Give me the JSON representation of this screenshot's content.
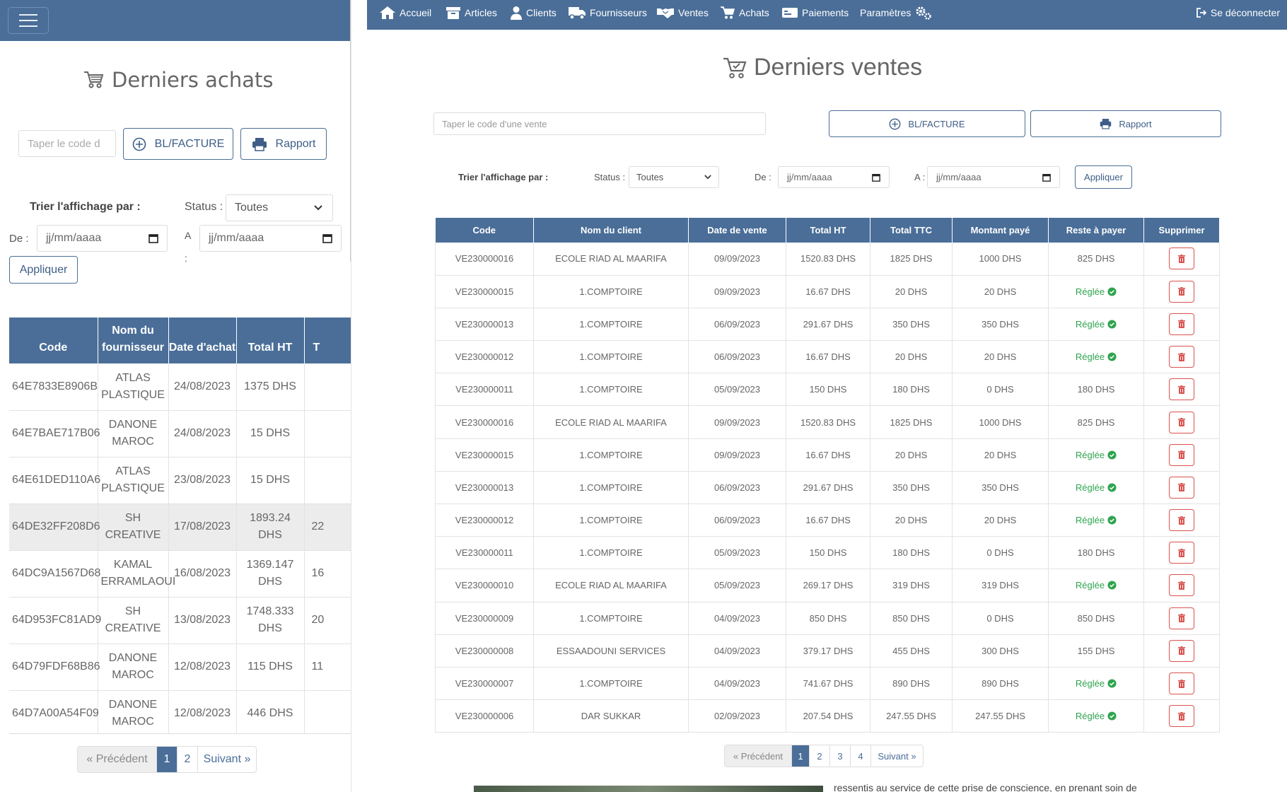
{
  "left_panel": {
    "title": "Derniers achats",
    "search_placeholder": "Taper le code d",
    "bl_label": "BL/FACTURE",
    "rapport_label": "Rapport",
    "sort_label": "Trier l'affichage par :",
    "status_label": "Status :",
    "status_value": "Toutes",
    "de_label": "De :",
    "a_label": "A :",
    "date_placeholder": "jj/mm/aaaa",
    "apply_label": "Appliquer",
    "columns": [
      "Code",
      "Nom du fournisseur",
      "Date d'achat",
      "Total HT",
      "T"
    ],
    "rows": [
      {
        "code": "64E7833E8906B",
        "fournisseur": "ATLAS PLASTIQUE",
        "date": "24/08/2023",
        "total_ht": "1375 DHS",
        "extra": ""
      },
      {
        "code": "64E7BAE717B06",
        "fournisseur": "DANONE MAROC",
        "date": "24/08/2023",
        "total_ht": "15 DHS",
        "extra": ""
      },
      {
        "code": "64E61DED110A6",
        "fournisseur": "ATLAS PLASTIQUE",
        "date": "23/08/2023",
        "total_ht": "15 DHS",
        "extra": ""
      },
      {
        "code": "64DE32FF208D6",
        "fournisseur": "SH CREATIVE",
        "date": "17/08/2023",
        "total_ht": "1893.24 DHS",
        "extra": "22"
      },
      {
        "code": "64DC9A1567D68",
        "fournisseur": "KAMAL ERRAMLAOUI",
        "date": "16/08/2023",
        "total_ht": "1369.147 DHS",
        "extra": "16"
      },
      {
        "code": "64D953FC81AD9",
        "fournisseur": "SH CREATIVE",
        "date": "13/08/2023",
        "total_ht": "1748.333 DHS",
        "extra": "20"
      },
      {
        "code": "64D79FDF68B86",
        "fournisseur": "DANONE MAROC",
        "date": "12/08/2023",
        "total_ht": "115 DHS",
        "extra": "11"
      },
      {
        "code": "64D7A00A54F09",
        "fournisseur": "DANONE MAROC",
        "date": "12/08/2023",
        "total_ht": "446 DHS",
        "extra": ""
      }
    ],
    "pager": {
      "prev": "« Précédent",
      "pages": [
        "1",
        "2"
      ],
      "next": "Suivant »"
    }
  },
  "nav": {
    "items": [
      "Accueil",
      "Articles",
      "Clients",
      "Fournisseurs",
      "Ventes",
      "Achats",
      "Paiements",
      "Paramètres"
    ],
    "logout": "Se déconnecter"
  },
  "right_panel": {
    "title": "Derniers ventes",
    "search_placeholder": "Taper le code d'une vente",
    "bl_label": "BL/FACTURE",
    "rapport_label": "Rapport",
    "sort_label": "Trier l'affichage par :",
    "status_label": "Status :",
    "status_value": "Toutes",
    "de_label": "De :",
    "a_label": "A :",
    "date_placeholder": "jj/mm/aaaa",
    "apply_label": "Appliquer",
    "columns": [
      "Code",
      "Nom du client",
      "Date de vente",
      "Total HT",
      "Total TTC",
      "Montant payé",
      "Reste à payer",
      "Supprimer"
    ],
    "rows": [
      {
        "code": "VE230000016",
        "client": "ECOLE RIAD AL MAARIFA",
        "date": "09/09/2023",
        "total_ht": "1520.83 DHS",
        "total_ttc": "1825 DHS",
        "paye": "1000 DHS",
        "reste": "825 DHS"
      },
      {
        "code": "VE230000015",
        "client": "1.COMPTOIRE",
        "date": "09/09/2023",
        "total_ht": "16.67 DHS",
        "total_ttc": "20 DHS",
        "paye": "20 DHS",
        "reste": "Réglée"
      },
      {
        "code": "VE230000013",
        "client": "1.COMPTOIRE",
        "date": "06/09/2023",
        "total_ht": "291.67 DHS",
        "total_ttc": "350 DHS",
        "paye": "350 DHS",
        "reste": "Réglée"
      },
      {
        "code": "VE230000012",
        "client": "1.COMPTOIRE",
        "date": "06/09/2023",
        "total_ht": "16.67 DHS",
        "total_ttc": "20 DHS",
        "paye": "20 DHS",
        "reste": "Réglée"
      },
      {
        "code": "VE230000011",
        "client": "1.COMPTOIRE",
        "date": "05/09/2023",
        "total_ht": "150 DHS",
        "total_ttc": "180 DHS",
        "paye": "0 DHS",
        "reste": "180 DHS"
      },
      {
        "code": "VE230000016",
        "client": "ECOLE RIAD AL MAARIFA",
        "date": "09/09/2023",
        "total_ht": "1520.83 DHS",
        "total_ttc": "1825 DHS",
        "paye": "1000 DHS",
        "reste": "825 DHS"
      },
      {
        "code": "VE230000015",
        "client": "1.COMPTOIRE",
        "date": "09/09/2023",
        "total_ht": "16.67 DHS",
        "total_ttc": "20 DHS",
        "paye": "20 DHS",
        "reste": "Réglée"
      },
      {
        "code": "VE230000013",
        "client": "1.COMPTOIRE",
        "date": "06/09/2023",
        "total_ht": "291.67 DHS",
        "total_ttc": "350 DHS",
        "paye": "350 DHS",
        "reste": "Réglée"
      },
      {
        "code": "VE230000012",
        "client": "1.COMPTOIRE",
        "date": "06/09/2023",
        "total_ht": "16.67 DHS",
        "total_ttc": "20 DHS",
        "paye": "20 DHS",
        "reste": "Réglée"
      },
      {
        "code": "VE230000011",
        "client": "1.COMPTOIRE",
        "date": "05/09/2023",
        "total_ht": "150 DHS",
        "total_ttc": "180 DHS",
        "paye": "0 DHS",
        "reste": "180 DHS"
      },
      {
        "code": "VE230000010",
        "client": "ECOLE RIAD AL MAARIFA",
        "date": "05/09/2023",
        "total_ht": "269.17 DHS",
        "total_ttc": "319 DHS",
        "paye": "319 DHS",
        "reste": "Réglée"
      },
      {
        "code": "VE230000009",
        "client": "1.COMPTOIRE",
        "date": "04/09/2023",
        "total_ht": "850 DHS",
        "total_ttc": "850 DHS",
        "paye": "0 DHS",
        "reste": "850 DHS"
      },
      {
        "code": "VE230000008",
        "client": "ESSAADOUNI SERVICES",
        "date": "04/09/2023",
        "total_ht": "379.17 DHS",
        "total_ttc": "455 DHS",
        "paye": "300 DHS",
        "reste": "155 DHS"
      },
      {
        "code": "VE230000007",
        "client": "1.COMPTOIRE",
        "date": "04/09/2023",
        "total_ht": "741.67 DHS",
        "total_ttc": "890 DHS",
        "paye": "890 DHS",
        "reste": "Réglée"
      },
      {
        "code": "VE230000006",
        "client": "DAR SUKKAR",
        "date": "02/09/2023",
        "total_ht": "207.54 DHS",
        "total_ttc": "247.55 DHS",
        "paye": "247.55 DHS",
        "reste": "Réglée"
      }
    ],
    "pager": {
      "prev": "« Précédent",
      "pages": [
        "1",
        "2",
        "3",
        "4"
      ],
      "next": "Suivant »"
    }
  },
  "footer_text": "ressentis au service de cette prise de conscience, en prenant soin de",
  "colors": {
    "primary": "#4a6e98",
    "paid": "#2ea44f",
    "danger": "#d9534f"
  },
  "icons": [
    "menu-icon",
    "cart-icon",
    "add-circle-icon",
    "print-icon",
    "calendar-icon",
    "chevron-down-icon",
    "home-icon",
    "box-icon",
    "user-icon",
    "truck-icon",
    "handshake-icon",
    "money-icon",
    "gears-icon",
    "logout-icon",
    "check-circle-icon",
    "trash-icon"
  ]
}
